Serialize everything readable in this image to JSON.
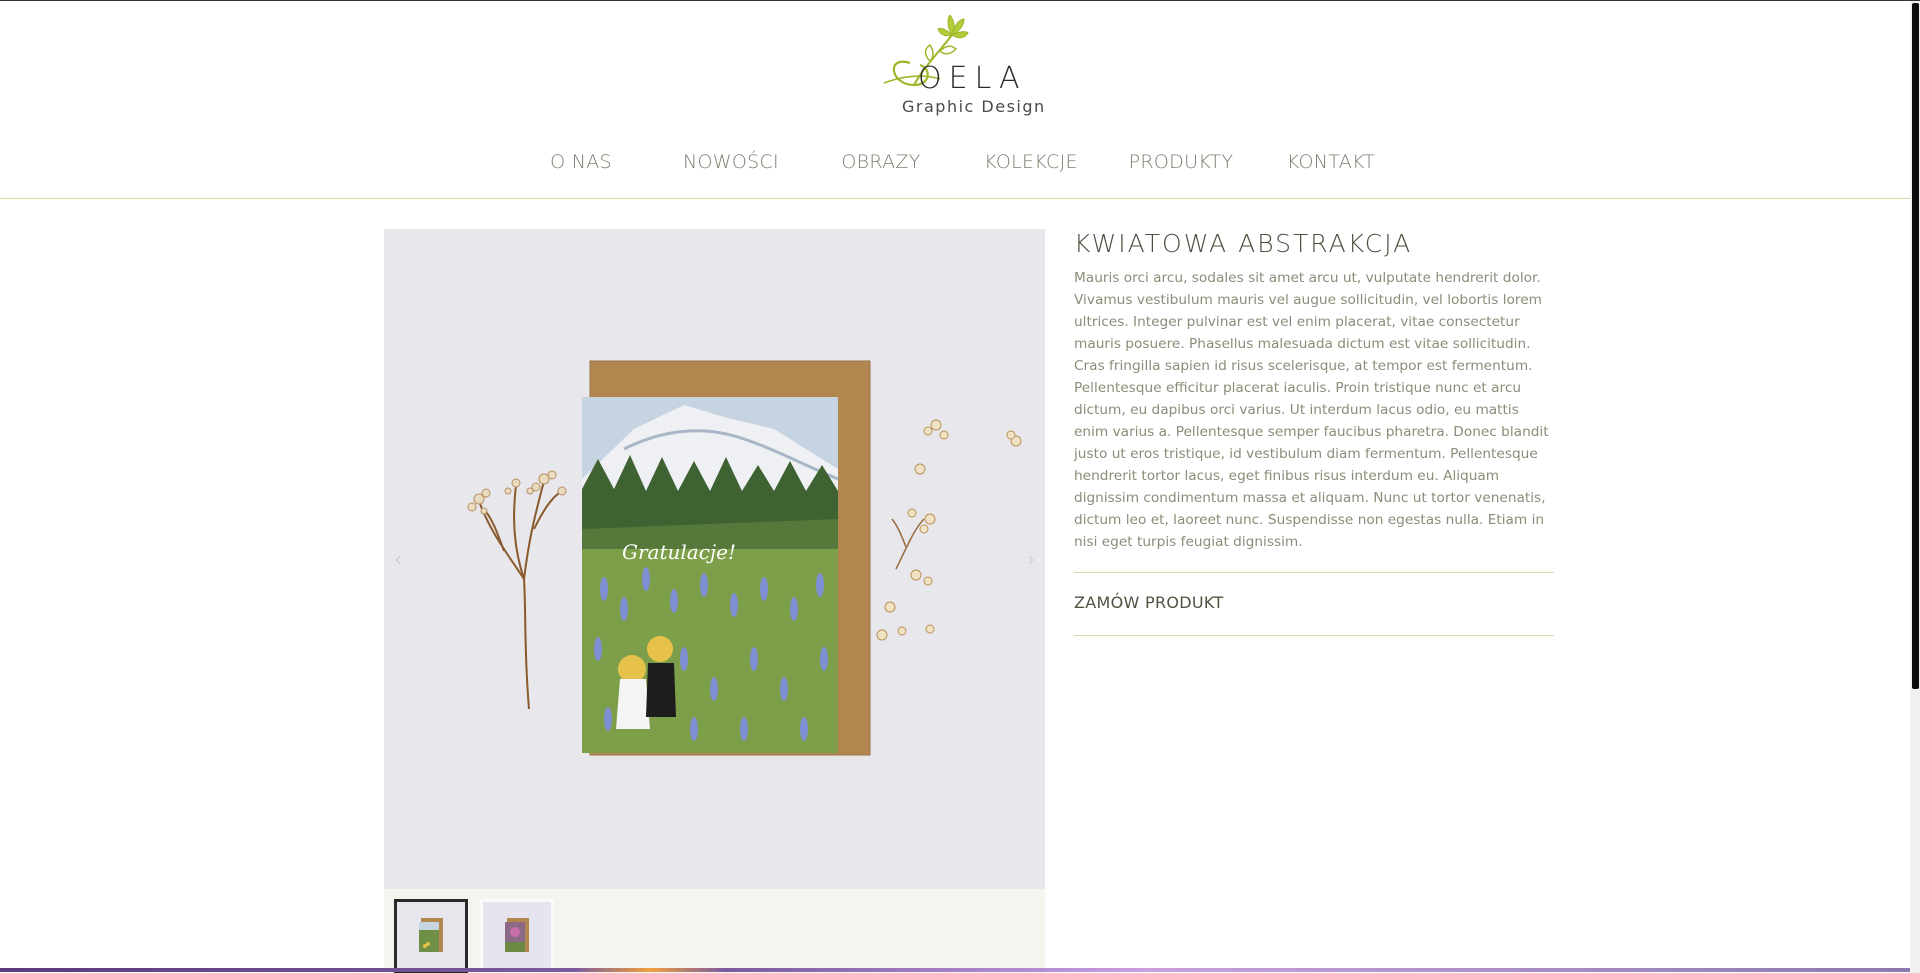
{
  "brand": {
    "name": "OELA",
    "tagline": "Graphic Design",
    "accent_color": "#9cb82a",
    "logo_icon": "flower-sprig-icon"
  },
  "nav": {
    "items": [
      {
        "label": "O NAS"
      },
      {
        "label": "NOWOŚCI"
      },
      {
        "label": "OBRAZY"
      },
      {
        "label": "KOLEKCJE"
      },
      {
        "label": "PRODUKTY"
      },
      {
        "label": "KONTAKT"
      }
    ]
  },
  "gallery": {
    "main_image_alt": "greeting card illustration",
    "card_text": "Gratulacje!",
    "prev_icon": "chevron-left-icon",
    "next_icon": "chevron-right-icon",
    "thumbnails": [
      {
        "name": "thumb-mountain-card",
        "active": true
      },
      {
        "name": "thumb-flower-card",
        "active": false
      }
    ]
  },
  "product": {
    "title": "KWIATOWA ABSTRAKCJA",
    "description": "Mauris orci arcu, sodales sit amet arcu ut, vulputate hendrerit dolor. Vivamus vestibulum mauris vel augue sollicitudin, vel lobortis lorem ultrices. Integer pulvinar est vel enim placerat, vitae consectetur mauris posuere. Phasellus malesuada dictum est vitae sollicitudin. Cras fringilla sapien id risus scelerisque, at tempor est fermentum. Pellentesque efficitur placerat iaculis. Proin tristique nunc et arcu dictum, eu dapibus orci varius. Ut interdum lacus odio, eu mattis enim varius a. Pellentesque semper faucibus pharetra. Donec blandit justo ut eros tristique, id vestibulum diam fermentum. Pellentesque hendrerit tortor lacus, eget finibus risus interdum eu. Aliquam dignissim condimentum massa et aliquam. Nunc ut tortor venenatis, dictum leo et, laoreet nunc. Suspendisse non egestas nulla. Etiam in nisi eget turpis feugiat dignissim.",
    "order_label": "ZAMÓW PRODUKT"
  }
}
